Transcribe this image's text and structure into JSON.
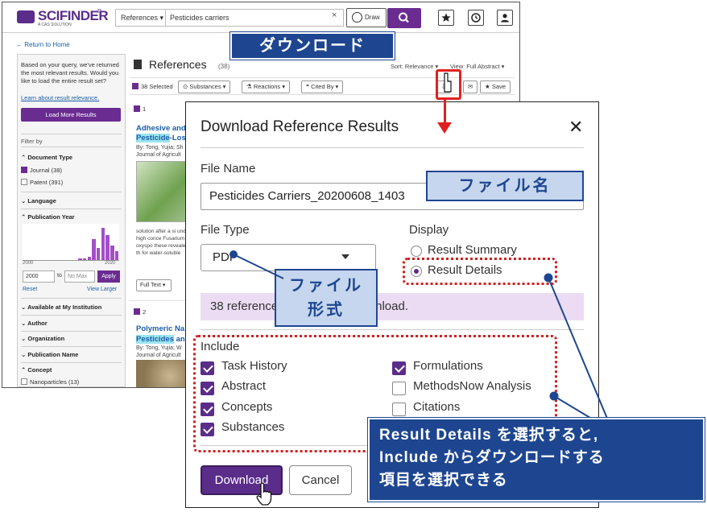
{
  "app": {
    "logo_text": "SCIFINDER",
    "logo_sup": "n",
    "logo_sub": "A CAS SOLUTION",
    "search_scope": "References ▾",
    "search_value": "Pesticides carriers",
    "draw_label": "Draw",
    "back_link": "← Return to Home"
  },
  "sidebar": {
    "note": "Based on your query, we've returned the most relevant results. Would you like to load the entire result set?",
    "relevance_link": "Learn about result relevance.",
    "load_more": "Load More Results",
    "filter_by": "Filter by",
    "document_type": "⌃ Document Type",
    "journal": "Journal (38)",
    "patent": "Patent (391)",
    "language": "⌄ Language",
    "pub_year": "⌃ Publication Year",
    "year_min_label": "2000",
    "year_max_label": "2020",
    "year_min": "2000",
    "year_to": "to",
    "year_max": "No Max",
    "apply": "Apply",
    "reset": "Reset",
    "view_larger": "View Larger",
    "available": "⌄ Available at My Institution",
    "author": "⌄ Author",
    "organization": "⌄ Organization",
    "pub_name": "⌄ Publication Name",
    "concept": "⌃ Concept",
    "nanoparticles": "Nanoparticles (13)",
    "histogram": [
      0,
      0,
      0,
      0,
      0,
      0,
      0,
      0,
      0,
      0,
      0,
      0,
      0.05,
      0.05,
      0.1,
      0.6,
      0.35,
      0.9,
      0.7,
      0.4,
      0.25
    ]
  },
  "main": {
    "title": "References",
    "count": "(38)",
    "sort": "Sort: Relevance ▾",
    "view": "View: Full Abstract ▾",
    "selected": "38 Selected",
    "substances": "Substances ▾",
    "reactions": "Reactions ▾",
    "cited_by": "Cited By ▾",
    "save": "Save",
    "r1_num": "1",
    "r1_title_a": "Adhesive and",
    "r1_title_hl": "Pesticide",
    "r1_title_b": "-Loss",
    "r1_by": "By: Tong, Yujia; Sh",
    "r1_jnl": "Journal of Agricult",
    "r1_abs": "solution after a si under high conce Fusarium oxyspo these revealed th for water-soluble",
    "full_text": "Full Text ▾",
    "r2_num": "2",
    "r2_title_a": "Polymeric Na",
    "r2_title_hl": "Pesticides",
    "r2_title_b": " an",
    "r2_by": "By: Tong, Yujia; W",
    "r2_jnl": "Journal of Agricult"
  },
  "dialog": {
    "title": "Download Reference Results",
    "close": "✕",
    "file_name_label": "File Name",
    "file_name": "Pesticides Carriers_20200608_1403",
    "file_type_label": "File Type",
    "file_type": "PDF",
    "display_label": "Display",
    "result_summary": "Result Summary",
    "result_details": "Result Details",
    "notice": "38 references selected for download.",
    "include_label": "Include",
    "include_left": [
      {
        "label": "Task History",
        "checked": true
      },
      {
        "label": "Abstract",
        "checked": true
      },
      {
        "label": "Concepts",
        "checked": true
      },
      {
        "label": "Substances",
        "checked": true
      }
    ],
    "include_right": [
      {
        "label": "Formulations",
        "checked": true
      },
      {
        "label": "MethodsNow Analysis",
        "checked": false
      },
      {
        "label": "Citations",
        "checked": false
      }
    ],
    "download": "Download",
    "cancel": "Cancel"
  },
  "callouts": {
    "download": "ダウンロード",
    "file_name": "ファイル名",
    "file_type_1": "ファイル",
    "file_type_2": "形式",
    "result_1": "Result Details を選択すると,",
    "result_2": "Include からダウンロードする",
    "result_3": "項目を選択できる"
  },
  "colors": {
    "brand": "#5b2d8a",
    "callout": "#1e4690",
    "annotation_red": "#e02020",
    "highlight": "#9ce4f0"
  }
}
